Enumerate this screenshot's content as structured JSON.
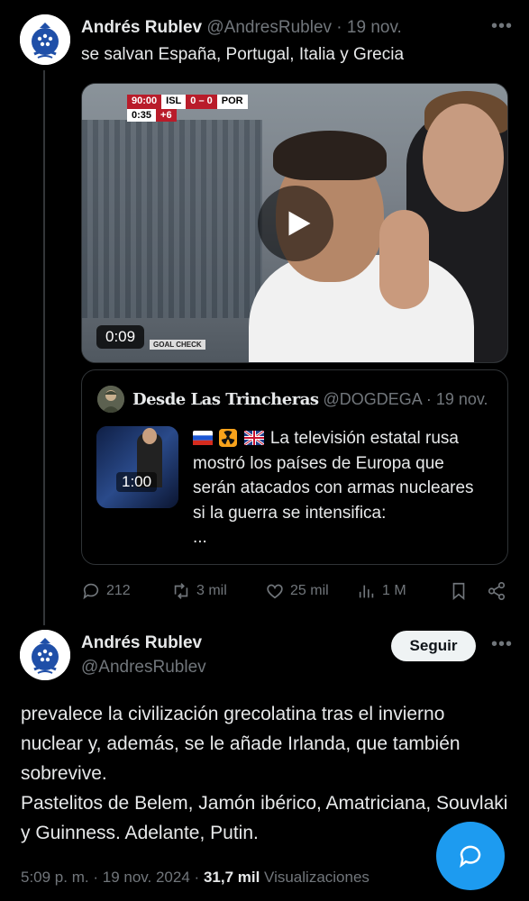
{
  "tweet1": {
    "author_name": "Andrés Rublev",
    "author_handle": "@AndresRublev",
    "separator": "·",
    "date": "19 nov.",
    "text": "se salvan España, Portugal, Italia y Grecia",
    "video": {
      "duration": "0:09",
      "scoreboard": {
        "time": "90:00",
        "home": "ISL",
        "score": "0 – 0",
        "away": "POR",
        "sub_time": "0:35",
        "added": "+6"
      },
      "caption": "GOAL CHECK",
      "icon": "play-icon"
    },
    "quote": {
      "author_name": "Desde Las Trincheras",
      "author_handle": "@DOGDEGA",
      "date": "19 nov.",
      "thumb_duration": "1:00",
      "text": "La televisión estatal rusa mostró los países de Europa que serán atacados con armas nucleares si la guerra se intensifica:",
      "ellipsis": "...",
      "emojis": [
        "russia-flag-icon",
        "radioactive-icon",
        "uk-flag-icon"
      ]
    },
    "actions": {
      "replies": "212",
      "retweets": "3 mil",
      "likes": "25 mil",
      "views": "1 M"
    }
  },
  "tweet2": {
    "author_name": "Andrés Rublev",
    "author_handle": "@AndresRublev",
    "follow_label": "Seguir",
    "text_lines": [
      "prevalece la civilización grecolatina tras el invierno nuclear y, además, se le añade Irlanda, que también sobrevive.",
      "Pastelitos de Belem, Jamón ibérico, Amatriciana, Souvlaki y Guinness. Adelante, Putin."
    ],
    "time": "5:09 p. m.",
    "date": "19 nov. 2024",
    "views_count": "31,7 mil",
    "views_label": "Visualizaciones"
  },
  "colors": {
    "background": "#000000",
    "text": "#e7e9ea",
    "muted": "#71767b",
    "accent": "#1d9bf0",
    "border": "#2f3336"
  }
}
